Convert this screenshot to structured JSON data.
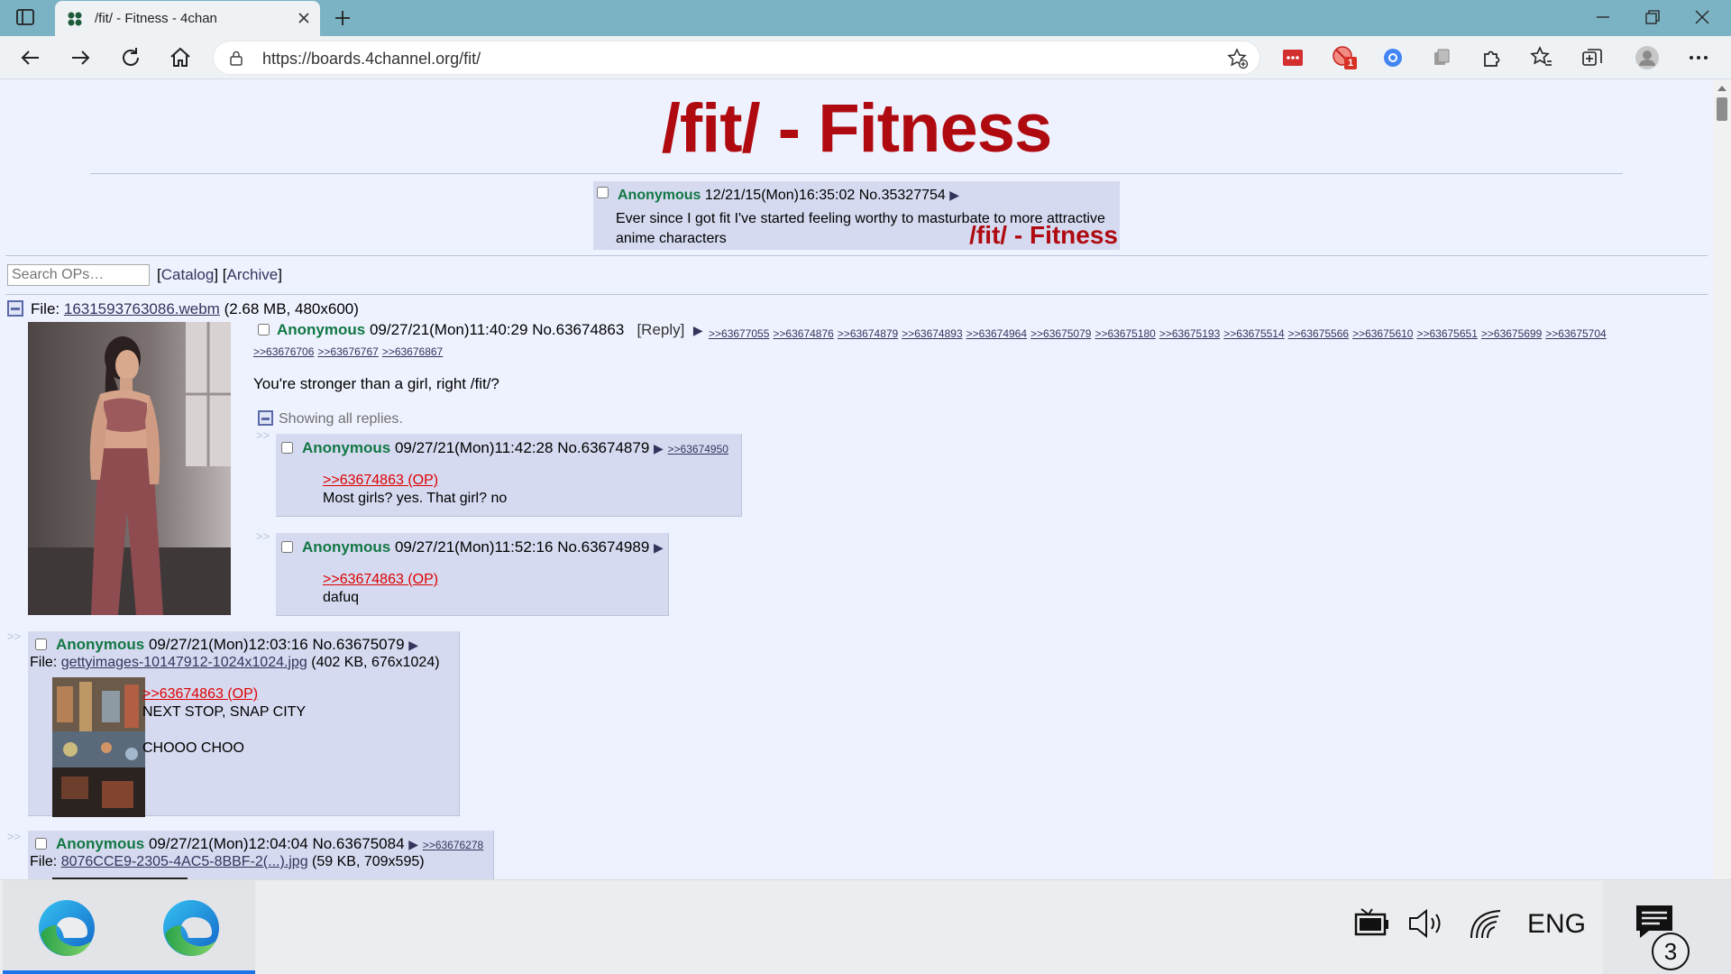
{
  "browser": {
    "tab_title": "/fit/ - Fitness - 4chan",
    "url": "https://boards.4channel.org/fit/",
    "extension_badge": "1"
  },
  "board": {
    "title": "/fit/ - Fitness",
    "banner_post": {
      "name": "Anonymous",
      "date": "12/21/15(Mon)16:35:02",
      "number": "No.35327754",
      "text": "Ever since I got fit I've started feeling worthy to masturbate to more attractive anime characters",
      "stamp": "/fit/ - Fitness"
    },
    "search_placeholder": "Search OPs…",
    "nav": {
      "open1": "[",
      "catalog": "Catalog",
      "mid": "] [",
      "archive": "Archive",
      "close1": "]"
    }
  },
  "thread": {
    "file_label": "File:",
    "file_name": "1631593763086.webm",
    "file_info": "(2.68 MB, 480x600)",
    "name": "Anonymous",
    "date": "09/27/21(Mon)11:40:29",
    "number": "No.63674863",
    "reply_label": "[Reply]",
    "backlinks": [
      ">>63677055",
      ">>63674876",
      ">>63674879",
      ">>63674893",
      ">>63674964",
      ">>63675079",
      ">>63675180",
      ">>63675193",
      ">>63675514",
      ">>63675566",
      ">>63675610",
      ">>63675651",
      ">>63675699",
      ">>63675704"
    ],
    "backlinks2": [
      ">>63676706",
      ">>63676767",
      ">>63676867"
    ],
    "comment": "You're stronger than a girl, right /fit/?",
    "showing_replies": "Showing all replies."
  },
  "replies": [
    {
      "name": "Anonymous",
      "date": "09/27/21(Mon)11:42:28",
      "number": "No.63674879",
      "backlink": ">>63674950",
      "quote": ">>63674863 (OP)",
      "text": "Most girls? yes. That girl? no"
    },
    {
      "name": "Anonymous",
      "date": "09/27/21(Mon)11:52:16",
      "number": "No.63674989",
      "quote": ">>63674863 (OP)",
      "text": "dafuq"
    },
    {
      "name": "Anonymous",
      "date": "09/27/21(Mon)12:03:16",
      "number": "No.63675079",
      "file_label": "File:",
      "file_name": "gettyimages-10147912-1024x1024.jpg",
      "file_info": "(402 KB, 676x1024)",
      "quote": ">>63674863 (OP)",
      "line1": "NEXT STOP, SNAP CITY",
      "line2": "CHOOO CHOO"
    },
    {
      "name": "Anonymous",
      "date": "09/27/21(Mon)12:04:04",
      "number": "No.63675084",
      "backlink": ">>63676278",
      "file_label": "File:",
      "file_name": "8076CCE9-2305-4AC5-8BBF-2(...).jpg",
      "file_info": "(59 KB, 709x595)"
    }
  ],
  "taskbar": {
    "language": "ENG",
    "notifications": "3"
  },
  "colors": {
    "tabbar": "#7cb3c4",
    "page_bg": "#eef2ff",
    "post_bg": "#d6daf0",
    "title_red": "#af0a0f",
    "name_green": "#117743",
    "quote_red": "#dd0000",
    "link_blue": "#34345c"
  }
}
